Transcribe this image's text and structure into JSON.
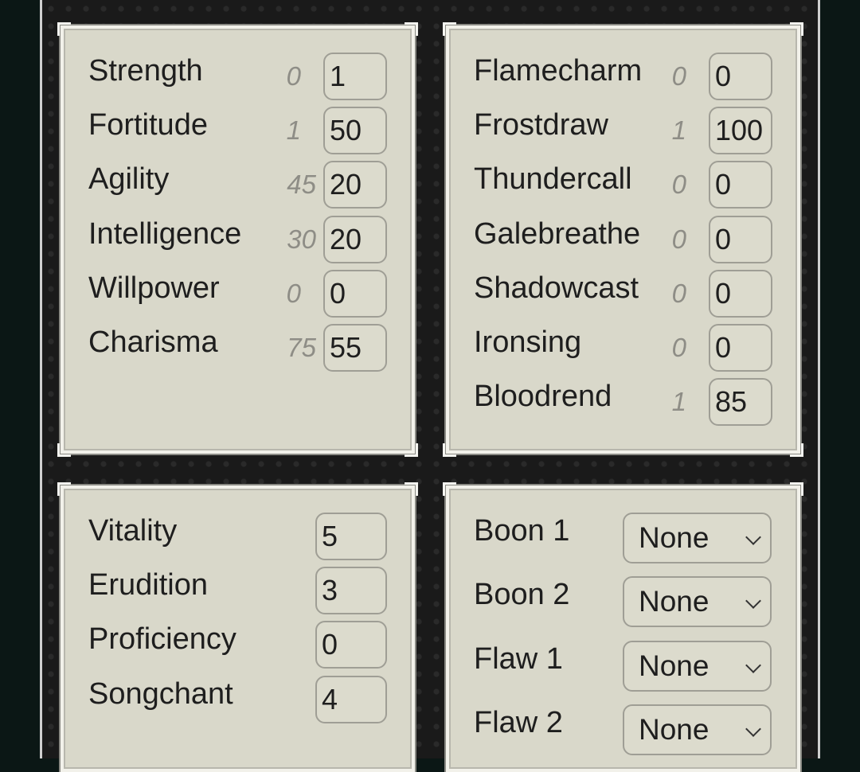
{
  "attributes": [
    {
      "label": "Strength",
      "base": "0",
      "value": "1"
    },
    {
      "label": "Fortitude",
      "base": "1",
      "value": "50"
    },
    {
      "label": "Agility",
      "base": "45",
      "value": "20"
    },
    {
      "label": "Intelligence",
      "base": "30",
      "value": "20"
    },
    {
      "label": "Willpower",
      "base": "0",
      "value": "0"
    },
    {
      "label": "Charisma",
      "base": "75",
      "value": "55"
    }
  ],
  "elements": [
    {
      "label": "Flamecharm",
      "base": "0",
      "value": "0"
    },
    {
      "label": "Frostdraw",
      "base": "1",
      "value": "100"
    },
    {
      "label": "Thundercall",
      "base": "0",
      "value": "0"
    },
    {
      "label": "Galebreathe",
      "base": "0",
      "value": "0"
    },
    {
      "label": "Shadowcast",
      "base": "0",
      "value": "0"
    },
    {
      "label": "Ironsing",
      "base": "0",
      "value": "0"
    },
    {
      "label": "Bloodrend",
      "base": "1",
      "value": "85"
    }
  ],
  "secondary": [
    {
      "label": "Vitality",
      "value": "5"
    },
    {
      "label": "Erudition",
      "value": "3"
    },
    {
      "label": "Proficiency",
      "value": "0"
    },
    {
      "label": "Songchant",
      "value": "4"
    }
  ],
  "traits": [
    {
      "label": "Boon 1",
      "value": "None"
    },
    {
      "label": "Boon 2",
      "value": "None"
    },
    {
      "label": "Flaw 1",
      "value": "None"
    },
    {
      "label": "Flaw 2",
      "value": "None"
    }
  ]
}
